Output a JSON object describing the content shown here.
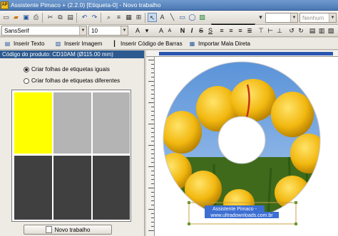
{
  "window": {
    "app_badge": "AP",
    "title": "Assistente Pimaco + (2.2.0)  [Etiqueta-0] - Novo trabalho"
  },
  "toolbar": {
    "icons": [
      "new-doc-icon",
      "open-folder-icon",
      "save-icon",
      "print-icon",
      "cut-icon",
      "copy-icon",
      "paste-icon",
      "undo-icon",
      "redo-icon",
      "zoom-icon",
      "align-icon",
      "select-pointer-icon",
      "text-tool-icon",
      "line-tool-icon",
      "rectangle-tool-icon",
      "ellipse-tool-icon",
      "image-tool-icon",
      "fill-color-icon"
    ],
    "fill_color": "#000000",
    "shadow_label": "Nenhum"
  },
  "format": {
    "font_family": "SansSerif",
    "font_size": "10",
    "bold_label": "N",
    "italic_label": "I",
    "strike_label": "S",
    "underline_label": "S"
  },
  "actions": {
    "insert_text": "Inserir Texto",
    "insert_image": "Inserir Imagem",
    "insert_barcode": "Inserir Código de Barras",
    "import_mail": "Importar Mala Direta"
  },
  "product": {
    "code_label": "Código do produto: CD10AM (Ø115.00 mm)"
  },
  "options": {
    "same_sheets": "Criar folhas de etiquetas iguais",
    "different_sheets": "Criar folhas de etiquetas diferentes",
    "selected": "same_sheets"
  },
  "sheet": {
    "cells": [
      {
        "color": "#ffff00"
      },
      {
        "color": "#b4b4b4"
      },
      {
        "color": "#b4b4b4"
      },
      {
        "color": "#404040"
      },
      {
        "color": "#404040"
      },
      {
        "color": "#404040"
      }
    ]
  },
  "new_job_button": "Novo trabalho",
  "label": {
    "line1": "Assistente Pimaco -",
    "line2": "www.ultradownloads.com.br"
  }
}
